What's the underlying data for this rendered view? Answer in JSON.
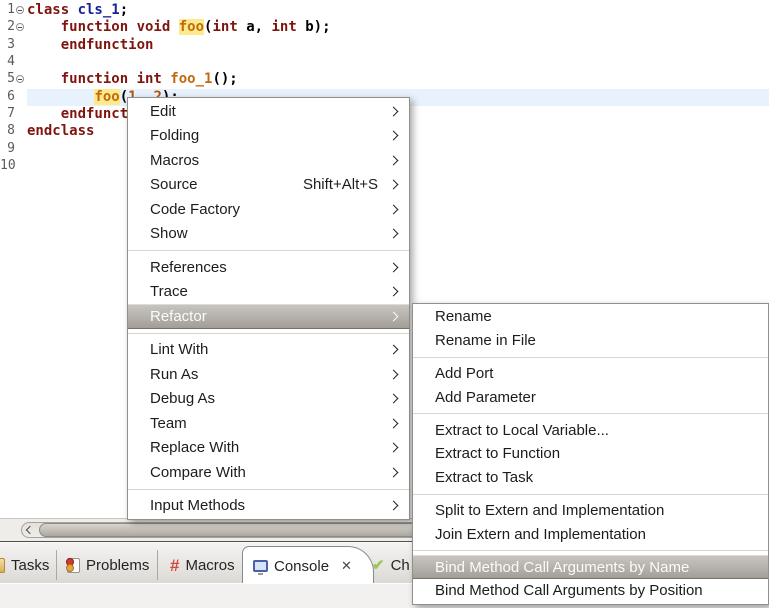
{
  "colors": {
    "keyword": "#7E150E",
    "class_name": "#18209C",
    "function_name": "#C2690E",
    "number_literal": "#B0550A",
    "occurrence_highlight_bg": "#FBEB8C",
    "current_line_bg": "#E8F2FC",
    "menu_highlight_top": "#C9C6C1",
    "menu_highlight_bottom": "#A19C95",
    "menu_highlight_text": "#FBFBFA"
  },
  "editor": {
    "lines": [
      {
        "num": "1",
        "fold": true,
        "segs": [
          [
            "class ",
            "kw"
          ],
          [
            "cls_1",
            "cls"
          ],
          [
            ";",
            "pl"
          ]
        ]
      },
      {
        "num": "2",
        "fold": true,
        "segs": [
          [
            "    ",
            "pl"
          ],
          [
            "function void ",
            "kw"
          ],
          [
            "foo",
            "occ"
          ],
          [
            "(",
            "pl"
          ],
          [
            "int",
            "kw"
          ],
          [
            " a, ",
            "pl"
          ],
          [
            "int",
            "kw"
          ],
          [
            " b);",
            "pl"
          ]
        ]
      },
      {
        "num": "3",
        "fold": false,
        "segs": [
          [
            "    ",
            "pl"
          ],
          [
            "endfunction",
            "kw"
          ]
        ]
      },
      {
        "num": "4",
        "fold": false,
        "segs": []
      },
      {
        "num": "5",
        "fold": true,
        "segs": [
          [
            "    ",
            "pl"
          ],
          [
            "function int ",
            "kw"
          ],
          [
            "foo_1",
            "fn"
          ],
          [
            "();",
            "pl"
          ]
        ]
      },
      {
        "num": "6",
        "fold": false,
        "current": true,
        "segs": [
          [
            "        ",
            "pl"
          ],
          [
            "foo",
            "occ"
          ],
          [
            "(",
            "pl"
          ],
          [
            "1",
            "num"
          ],
          [
            ", ",
            "pl"
          ],
          [
            "2",
            "num"
          ],
          [
            ");",
            "pl"
          ]
        ]
      },
      {
        "num": "7",
        "fold": false,
        "segs": [
          [
            "    ",
            "pl"
          ],
          [
            "endfunction",
            "kw"
          ]
        ]
      },
      {
        "num": "8",
        "fold": false,
        "segs": [
          [
            "endclass",
            "kw"
          ]
        ]
      },
      {
        "num": "9",
        "fold": false,
        "segs": []
      },
      {
        "num": "10",
        "fold": false,
        "segs": []
      }
    ]
  },
  "context_menu": {
    "items": [
      {
        "label": "Edit",
        "submenu": true
      },
      {
        "label": "Folding",
        "submenu": true
      },
      {
        "label": "Macros",
        "submenu": true
      },
      {
        "label": "Source",
        "accel": "Shift+Alt+S",
        "submenu": true
      },
      {
        "label": "Code Factory",
        "submenu": true
      },
      {
        "label": "Show",
        "submenu": true
      },
      {
        "sep": true
      },
      {
        "label": "References",
        "submenu": true
      },
      {
        "label": "Trace",
        "submenu": true
      },
      {
        "label": "Refactor",
        "submenu": true,
        "highlight": true
      },
      {
        "sep": true
      },
      {
        "label": "Lint With",
        "submenu": true
      },
      {
        "label": "Run As",
        "submenu": true
      },
      {
        "label": "Debug As",
        "submenu": true
      },
      {
        "label": "Team",
        "submenu": true
      },
      {
        "label": "Replace With",
        "submenu": true
      },
      {
        "label": "Compare With",
        "submenu": true
      },
      {
        "sep": true
      },
      {
        "label": "Input Methods",
        "submenu": true
      }
    ]
  },
  "refactor_submenu": {
    "items": [
      {
        "label": "Rename"
      },
      {
        "label": "Rename in File"
      },
      {
        "sep": true
      },
      {
        "label": "Add Port"
      },
      {
        "label": "Add Parameter"
      },
      {
        "sep": true
      },
      {
        "label": "Extract to Local Variable..."
      },
      {
        "label": "Extract to Function"
      },
      {
        "label": "Extract to Task"
      },
      {
        "sep": true
      },
      {
        "label": "Split to Extern and Implementation"
      },
      {
        "label": "Join Extern and Implementation"
      },
      {
        "sep": true
      },
      {
        "label": "Bind Method Call Arguments by Name",
        "highlight": true
      },
      {
        "label": "Bind Method Call Arguments by Position"
      }
    ]
  },
  "bottom_tabs": {
    "items": [
      {
        "label": "Tasks"
      },
      {
        "label": "Problems"
      },
      {
        "label": "Macros"
      },
      {
        "label": "Console",
        "active": true,
        "closable": true
      },
      {
        "label": "Ch"
      }
    ],
    "close_glyph": "✕",
    "macros_glyph": "#",
    "checks_glyph": "✔"
  }
}
